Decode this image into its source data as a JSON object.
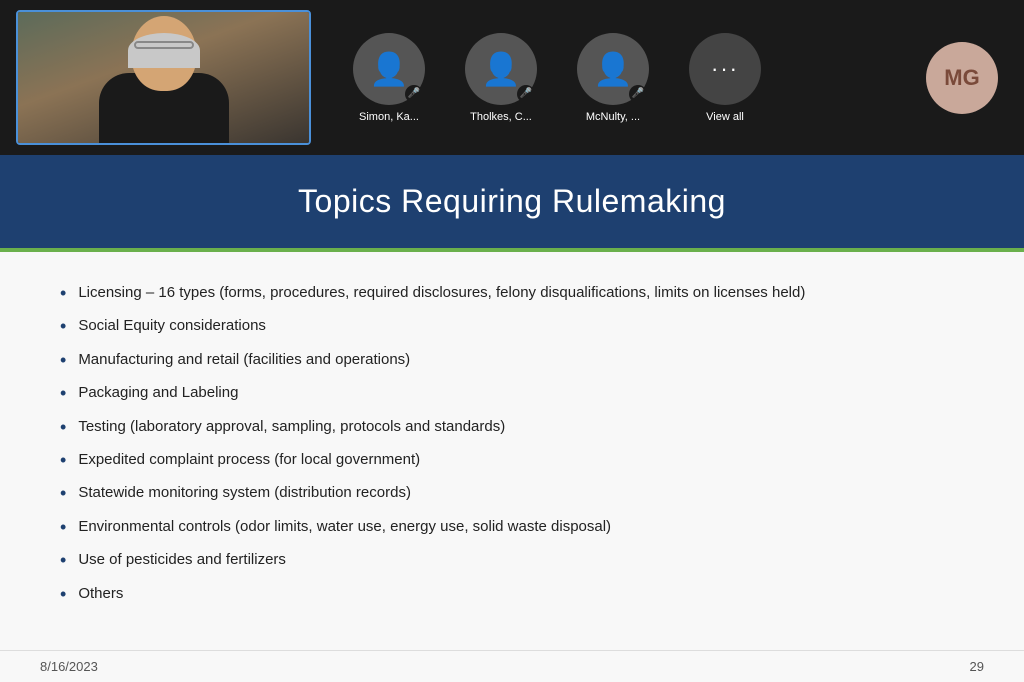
{
  "topbar": {
    "background": "#1a1a1a"
  },
  "participants": [
    {
      "id": "simon",
      "name": "Simon, Ka...",
      "mic_muted": true
    },
    {
      "id": "tholkes",
      "name": "Tholkes, C...",
      "mic_muted": true
    },
    {
      "id": "mcnulty",
      "name": "McNulty, ...",
      "mic_muted": true
    }
  ],
  "more_button_label": "···",
  "view_all_label": "View all",
  "mg_initials": "MG",
  "slide": {
    "title": "Topics Requiring Rulemaking",
    "header_bg": "#1e4070",
    "accent_color": "#6ab04c",
    "bullets": [
      "Licensing – 16 types (forms, procedures, required disclosures, felony disqualifications, limits on licenses held)",
      "Social Equity considerations",
      "Manufacturing and retail (facilities and operations)",
      "Packaging and Labeling",
      "Testing (laboratory approval, sampling, protocols and standards)",
      "Expedited complaint process (for local government)",
      "Statewide monitoring system (distribution records)",
      "Environmental controls (odor limits, water use, energy use, solid waste disposal)",
      "Use of pesticides and fertilizers",
      "Others"
    ],
    "date": "8/16/2023",
    "page_number": "29"
  }
}
